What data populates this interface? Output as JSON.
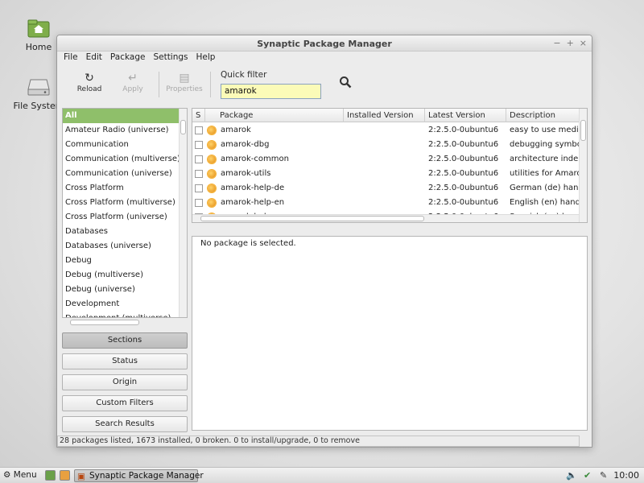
{
  "desktop": {
    "icons": [
      {
        "label": "Home",
        "icon": "folder-home-icon"
      },
      {
        "label": "File System",
        "icon": "hard-drive-icon"
      }
    ]
  },
  "window": {
    "title": "Synaptic Package Manager",
    "menu": [
      "File",
      "Edit",
      "Package",
      "Settings",
      "Help"
    ],
    "toolbar": {
      "reload": "Reload",
      "apply": "Apply",
      "properties": "Properties",
      "quick_filter_label": "Quick filter",
      "quick_filter_value": "amarok"
    },
    "sections": [
      "All",
      "Amateur Radio (universe)",
      "Communication",
      "Communication (multiverse)",
      "Communication (universe)",
      "Cross Platform",
      "Cross Platform (multiverse)",
      "Cross Platform (universe)",
      "Databases",
      "Databases (universe)",
      "Debug",
      "Debug (multiverse)",
      "Debug (universe)",
      "Development",
      "Development (multiverse)"
    ],
    "filter_buttons": [
      "Sections",
      "Status",
      "Origin",
      "Custom Filters",
      "Search Results"
    ],
    "package_columns": [
      "S",
      "Package",
      "Installed Version",
      "Latest Version",
      "Description"
    ],
    "packages": [
      {
        "name": "amarok",
        "installed": "",
        "latest": "2:2.5.0-0ubuntu6",
        "desc": "easy to use media"
      },
      {
        "name": "amarok-dbg",
        "installed": "",
        "latest": "2:2.5.0-0ubuntu6",
        "desc": "debugging symbo"
      },
      {
        "name": "amarok-common",
        "installed": "",
        "latest": "2:2.5.0-0ubuntu6",
        "desc": "architecture indep"
      },
      {
        "name": "amarok-utils",
        "installed": "",
        "latest": "2:2.5.0-0ubuntu6",
        "desc": "utilities for Amarol"
      },
      {
        "name": "amarok-help-de",
        "installed": "",
        "latest": "2:2.5.0-0ubuntu6",
        "desc": "German (de) hand"
      },
      {
        "name": "amarok-help-en",
        "installed": "",
        "latest": "2:2.5.0-0ubuntu6",
        "desc": "English (en) hand"
      },
      {
        "name": "amarok-help-es",
        "installed": "",
        "latest": "2:2.5.0-0ubuntu6",
        "desc": "Spanish (es) hand"
      }
    ],
    "description_text": "No package is selected.",
    "status_text": "28 packages listed, 1673 installed, 0 broken. 0 to install/upgrade, 0 to remove"
  },
  "panel": {
    "menu_label": "Menu",
    "task_label": "Synaptic Package Manager",
    "clock": "10:00"
  },
  "colors": {
    "selected_section": "#8fbf6a",
    "quick_filter_bg": "#fbfbb8",
    "package_status_icon": "#e38a10"
  }
}
